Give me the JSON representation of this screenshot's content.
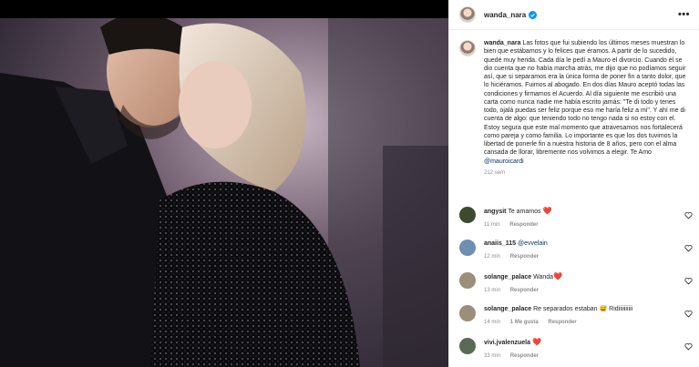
{
  "post": {
    "username": "wanda_nara",
    "caption_text": "Las fotos que fui subiendo los últimos meses muestran lo bien que estábamos y lo felices que éramos. A partir de lo sucedido, quedé muy herida. Cada día le pedí a Mauro el divorcio. Cuando él se dio cuenta que no había marcha atrás, me dijo que no podíamos seguir así, que si separamos era la única forma de poner fin a tanto dolor, que lo hiciéramos. Fuimos al abogado. En dos días Mauro aceptó todas las condiciones y firmamos el Acuerdo. Al día siguiente me escribió una carta como nunca nadie me había escrito jamás: \"Te di todo y tenes todo, ojalá puedas ser feliz porque eso me haría feliz a mi\". Y ahí me di cuenta de algo: que teniendo todo no tengo nada si no estoy con el. Estoy segura que este mal momento que atravesamos nos fortalecerá como pareja y como familia. Lo importante es que los dos tuvimos la libertad de ponerle fin a nuestra historia de 8 años, pero con el alma cansada de llorar, libremente nos volvimos a elegir. Te Amo",
    "caption_mention": "@mauroicardi",
    "caption_time": "212 sem",
    "more_label": "•••"
  },
  "comments": [
    {
      "username": "angysit",
      "text": "Te amamos",
      "emoji": "❤️",
      "time": "11 min",
      "likes": "",
      "reply": "Responder",
      "avatar_color": "#3d4a2e"
    },
    {
      "username": "anaiis_115",
      "text": "",
      "mention": "@evvelain",
      "time": "12 min",
      "likes": "",
      "reply": "Responder",
      "avatar_color": "#6d8fb0"
    },
    {
      "username": "solange_palace",
      "text": "Wanda",
      "emoji": "❤️",
      "time": "13 min",
      "likes": "",
      "reply": "Responder",
      "avatar_color": "#9c8f7a"
    },
    {
      "username": "solange_palace",
      "text": "Re separados estaban",
      "emoji": "😅",
      "tail": "Ridiiiiiiiiii",
      "time": "14 min",
      "likes": "1 Me gusta",
      "reply": "Responder",
      "avatar_color": "#9c8f7a"
    },
    {
      "username": "vivi.jvalenzuela",
      "text": "",
      "emoji": "❤️",
      "time": "33 min",
      "likes": "",
      "reply": "Responder",
      "avatar_color": "#5a6b55"
    }
  ],
  "colors": {
    "verified": "#0095f6",
    "heart_emoji": "#e0245e",
    "meta": "#8e8e8e",
    "link": "#00376b"
  },
  "icons": {
    "verified": "verified-badge-icon",
    "like": "heart-outline-icon",
    "more": "more-options-icon"
  }
}
